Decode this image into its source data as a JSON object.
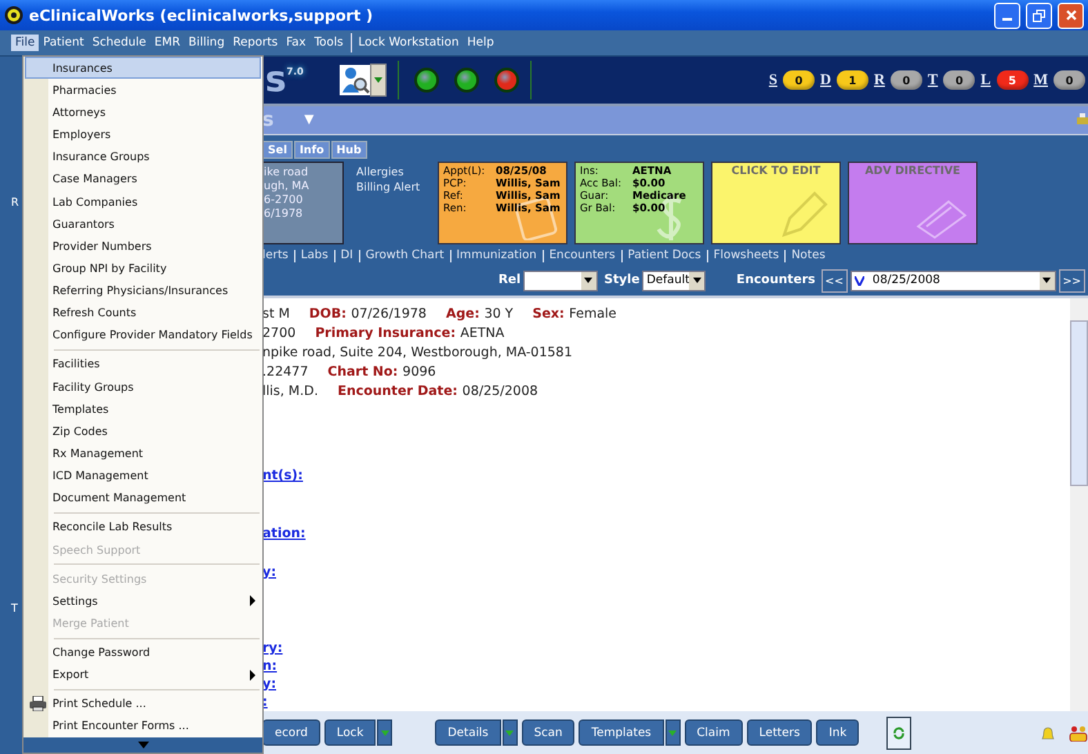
{
  "window": {
    "title": "eClinicalWorks (eclinicalworks,support )"
  },
  "menu_bar": [
    {
      "label": "File",
      "selected": true
    },
    {
      "label": "Patient",
      "selected": false
    },
    {
      "label": "Schedule",
      "selected": false
    },
    {
      "label": "EMR",
      "selected": false
    },
    {
      "label": "Billing",
      "selected": false
    },
    {
      "label": "Reports",
      "selected": false
    },
    {
      "label": "Fax",
      "selected": false
    },
    {
      "label": "Tools",
      "selected": false
    },
    {
      "label": "Lock Workstation",
      "selected": false
    },
    {
      "label": "Help",
      "selected": false
    }
  ],
  "file_menu": {
    "groups": [
      [
        {
          "label": "Insurances",
          "selected": true,
          "disabled": false,
          "submenu": false,
          "icon": false
        },
        {
          "label": "Pharmacies",
          "selected": false,
          "disabled": false,
          "submenu": false,
          "icon": false
        },
        {
          "label": "Attorneys",
          "selected": false,
          "disabled": false,
          "submenu": false,
          "icon": false
        },
        {
          "label": "Employers",
          "selected": false,
          "disabled": false,
          "submenu": false,
          "icon": false
        },
        {
          "label": "Insurance Groups",
          "selected": false,
          "disabled": false,
          "submenu": false,
          "icon": false
        },
        {
          "label": "Case Managers",
          "selected": false,
          "disabled": false,
          "submenu": false,
          "icon": false
        },
        {
          "label": "Lab Companies",
          "selected": false,
          "disabled": false,
          "submenu": false,
          "icon": false
        },
        {
          "label": "Guarantors",
          "selected": false,
          "disabled": false,
          "submenu": false,
          "icon": false
        },
        {
          "label": "Provider Numbers",
          "selected": false,
          "disabled": false,
          "submenu": false,
          "icon": false
        },
        {
          "label": "Group NPI by Facility",
          "selected": false,
          "disabled": false,
          "submenu": false,
          "icon": false
        },
        {
          "label": "Referring Physicians/Insurances",
          "selected": false,
          "disabled": false,
          "submenu": false,
          "icon": false
        },
        {
          "label": "Refresh Counts",
          "selected": false,
          "disabled": false,
          "submenu": false,
          "icon": false
        },
        {
          "label": "Configure Provider Mandatory Fields",
          "selected": false,
          "disabled": false,
          "submenu": false,
          "icon": false
        }
      ],
      [
        {
          "label": "Facilities",
          "selected": false,
          "disabled": false,
          "submenu": false,
          "icon": false
        },
        {
          "label": "Facility Groups",
          "selected": false,
          "disabled": false,
          "submenu": false,
          "icon": false
        },
        {
          "label": "Templates",
          "selected": false,
          "disabled": false,
          "submenu": false,
          "icon": false
        },
        {
          "label": "Zip Codes",
          "selected": false,
          "disabled": false,
          "submenu": false,
          "icon": false
        },
        {
          "label": "Rx Management",
          "selected": false,
          "disabled": false,
          "submenu": false,
          "icon": false
        },
        {
          "label": "ICD Management",
          "selected": false,
          "disabled": false,
          "submenu": false,
          "icon": false
        },
        {
          "label": "Document Management",
          "selected": false,
          "disabled": false,
          "submenu": false,
          "icon": false
        }
      ],
      [
        {
          "label": "Reconcile Lab Results",
          "selected": false,
          "disabled": false,
          "submenu": false,
          "icon": false
        },
        {
          "label": "Speech Support",
          "selected": false,
          "disabled": true,
          "submenu": false,
          "icon": false
        }
      ],
      [
        {
          "label": "Security Settings",
          "selected": false,
          "disabled": true,
          "submenu": false,
          "icon": false
        },
        {
          "label": "Settings",
          "selected": false,
          "disabled": false,
          "submenu": true,
          "icon": false
        },
        {
          "label": "Merge Patient",
          "selected": false,
          "disabled": true,
          "submenu": false,
          "icon": false
        }
      ],
      [
        {
          "label": "Change Password",
          "selected": false,
          "disabled": false,
          "submenu": false,
          "icon": false
        },
        {
          "label": "Export",
          "selected": false,
          "disabled": false,
          "submenu": true,
          "icon": false
        }
      ],
      [
        {
          "label": "Print Schedule ...",
          "selected": false,
          "disabled": false,
          "submenu": false,
          "icon": true
        },
        {
          "label": "Print Encounter Forms ...",
          "selected": false,
          "disabled": false,
          "submenu": false,
          "icon": false
        }
      ]
    ]
  },
  "left_strip": [
    "R",
    "T"
  ],
  "toolbar": {
    "logo": "s",
    "version": "7.0",
    "lights": [
      {
        "color": "#22b022"
      },
      {
        "color": "#22b022"
      },
      {
        "color": "#e02a1a"
      }
    ],
    "counters": [
      {
        "letter": "S",
        "count": "0",
        "color": "#f7c81a"
      },
      {
        "letter": "D",
        "count": "1",
        "color": "#f7c81a"
      },
      {
        "letter": "R",
        "count": "0",
        "color": "#a8a8a8"
      },
      {
        "letter": "T",
        "count": "0",
        "color": "#a8a8a8"
      },
      {
        "letter": "L",
        "count": "5",
        "color": "#f02a1a"
      },
      {
        "letter": "M",
        "count": "0",
        "color": "#a8a8a8"
      }
    ]
  },
  "sub_bar": {
    "title": "s",
    "caret": "▼"
  },
  "patient_tabs": [
    "Sel",
    "Info",
    "Hub"
  ],
  "address_card": [
    "ike road",
    "ugh, MA",
    "6-2700",
    "6/1978"
  ],
  "alerts": [
    "Allergies",
    "Billing Alert"
  ],
  "cards": [
    {
      "kind": "info",
      "color": "#f6a940",
      "rows": [
        {
          "label": "Appt(L):",
          "value": "08/25/08"
        },
        {
          "label": "PCP:",
          "value": "Willis, Sam"
        },
        {
          "label": "Ref:",
          "value": "Willis, Sam"
        },
        {
          "label": "Ren:",
          "value": "Willis, Sam"
        }
      ]
    },
    {
      "kind": "info",
      "color": "#a3dc7c",
      "rows": [
        {
          "label": "Ins:",
          "value": "AETNA"
        },
        {
          "label": "Acc Bal:",
          "value": "$0.00"
        },
        {
          "label": "Guar:",
          "value": "Medicare"
        },
        {
          "label": "Gr Bal:",
          "value": "$0.00"
        }
      ]
    },
    {
      "kind": "title",
      "color": "#fbf46c",
      "title": "CLICK TO EDIT"
    },
    {
      "kind": "title",
      "color": "#c47cee",
      "title": "ADV DIRECTIVE"
    }
  ],
  "nav_links": [
    "lerts",
    "Labs",
    "DI",
    "Growth Chart",
    "Immunization",
    "Encounters",
    "Patient Docs",
    "Flowsheets",
    "Notes"
  ],
  "filters": {
    "rel_label": "Rel",
    "style_label": "Style",
    "style_value": "Default",
    "encounters_label": "Encounters",
    "prev": "<<",
    "encounter_value": "08/25/2008",
    "next": ">>"
  },
  "demographics": [
    [
      {
        "value": "st M"
      },
      {
        "label": "DOB:",
        "value": "07/26/1978"
      },
      {
        "label": "Age:",
        "value": "30 Y"
      },
      {
        "label": "Sex:",
        "value": "Female"
      }
    ],
    [
      {
        "value": "2700"
      },
      {
        "label": "Primary Insurance:",
        "value": "AETNA"
      }
    ],
    [
      {
        "value": "npike road, Suite 204, Westborough, MA-01581"
      }
    ],
    [
      {
        "value": ".22477"
      },
      {
        "label": "Chart No:",
        "value": "9096"
      }
    ],
    [
      {
        "value": "llis, M.D."
      },
      {
        "label": "Encounter Date:",
        "value": "08/25/2008"
      }
    ]
  ],
  "sections": [
    "nt(s):",
    "ation:",
    "y:",
    "ry:",
    "n:",
    "y:",
    ":"
  ],
  "bottom_buttons": [
    {
      "label": "ecord",
      "dropdown": false
    },
    {
      "label": "Lock",
      "dropdown": true
    },
    {
      "label": "Details",
      "dropdown": true
    },
    {
      "label": "Scan",
      "dropdown": false
    },
    {
      "label": "Templates",
      "dropdown": true
    },
    {
      "label": "Claim",
      "dropdown": false
    },
    {
      "label": "Letters",
      "dropdown": false
    },
    {
      "label": "Ink",
      "dropdown": false
    }
  ]
}
